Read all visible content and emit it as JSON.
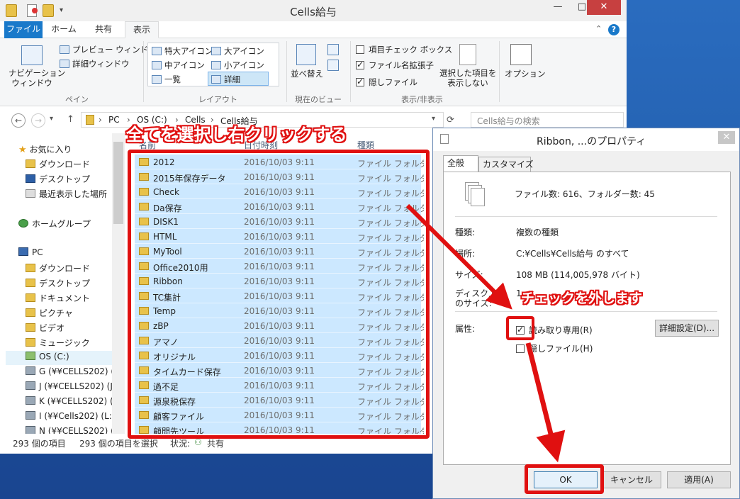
{
  "explorer": {
    "title": "Cells給与",
    "tabs": [
      "ファイル",
      "ホーム",
      "共有",
      "表示"
    ],
    "ribbon": {
      "pane": {
        "nav_pane": "ナビゲーション\nウィンドウ",
        "preview": "プレビュー ウィンドウ",
        "details": "詳細ウィンドウ",
        "group": "ペイン"
      },
      "layout": {
        "xl_icons": "特大アイコン",
        "l_icons": "大アイコン",
        "m_icons": "中アイコン",
        "s_icons": "小アイコン",
        "list": "一覧",
        "details": "詳細",
        "group": "レイアウト"
      },
      "current_view": {
        "sort": "並べ替え",
        "group": "現在のビュー"
      },
      "show_hide": {
        "item_checkbox": "項目チェック ボックス",
        "ext": "ファイル名拡張子",
        "hidden": "隠しファイル",
        "hide_selected": "選択した項目を\n表示しない",
        "group": "表示/非表示"
      },
      "options": "オプション"
    },
    "address": {
      "crumbs": [
        "PC",
        "OS (C:)",
        "Cells",
        "Cells給与"
      ],
      "search_placeholder": "Cells給与の検索"
    },
    "nav": {
      "favorites": "お気に入り",
      "fav_items": [
        "ダウンロード",
        "デスクトップ",
        "最近表示した場所"
      ],
      "homegroup": "ホームグループ",
      "pc": "PC",
      "pc_items": [
        "ダウンロード",
        "デスクトップ",
        "ドキュメント",
        "ピクチャ",
        "ビデオ",
        "ミュージック",
        "OS (C:)",
        "G (¥¥CELLS202) (",
        "J (¥¥CELLS202) (J",
        "K (¥¥CELLS202) (",
        "I (¥¥Cells202) (L:",
        "N (¥¥CELLS202) ("
      ]
    },
    "columns": {
      "name": "名前",
      "date": "日付時刻",
      "type": "種類"
    },
    "files": [
      {
        "name": "2012",
        "date": "2016/10/03 9:11",
        "type": "ファイル フォルダー"
      },
      {
        "name": "2015年保存データ",
        "date": "2016/10/03 9:11",
        "type": "ファイル フォルダー"
      },
      {
        "name": "Check",
        "date": "2016/10/03 9:11",
        "type": "ファイル フォルダー"
      },
      {
        "name": "Da保存",
        "date": "2016/10/03 9:11",
        "type": "ファイル フォルダー"
      },
      {
        "name": "DISK1",
        "date": "2016/10/03 9:11",
        "type": "ファイル フォルダー"
      },
      {
        "name": "HTML",
        "date": "2016/10/03 9:11",
        "type": "ファイル フォルダー"
      },
      {
        "name": "MyTool",
        "date": "2016/10/03 9:11",
        "type": "ファイル フォルダー"
      },
      {
        "name": "Office2010用",
        "date": "2016/10/03 9:11",
        "type": "ファイル フォルダー"
      },
      {
        "name": "Ribbon",
        "date": "2016/10/03 9:11",
        "type": "ファイル フォルダー"
      },
      {
        "name": "TC集計",
        "date": "2016/10/03 9:11",
        "type": "ファイル フォルダー"
      },
      {
        "name": "Temp",
        "date": "2016/10/03 9:11",
        "type": "ファイル フォルダー"
      },
      {
        "name": "zBP",
        "date": "2016/10/03 9:11",
        "type": "ファイル フォルダー"
      },
      {
        "name": "アマノ",
        "date": "2016/10/03 9:11",
        "type": "ファイル フォルダー"
      },
      {
        "name": "オリジナル",
        "date": "2016/10/03 9:11",
        "type": "ファイル フォルダー"
      },
      {
        "name": "タイムカード保存",
        "date": "2016/10/03 9:11",
        "type": "ファイル フォルダー"
      },
      {
        "name": "過不足",
        "date": "2016/10/03 9:11",
        "type": "ファイル フォルダー"
      },
      {
        "name": "源泉税保存",
        "date": "2016/10/03 9:11",
        "type": "ファイル フォルダー"
      },
      {
        "name": "顧客ファイル",
        "date": "2016/10/03 9:11",
        "type": "ファイル フォルダー"
      },
      {
        "name": "顧問先ツール",
        "date": "2016/10/03 9:11",
        "type": "ファイル フォルダー"
      }
    ],
    "status": {
      "count": "293 個の項目",
      "selected": "293 個の項目を選択",
      "state": "状況:",
      "shared": "共有"
    }
  },
  "annotations": {
    "select_all": "全てを選択し右クリックする",
    "uncheck": "チェックを外します"
  },
  "dialog": {
    "title": "Ribbon, ...のプロパティ",
    "tabs": [
      "全般",
      "カスタマイズ"
    ],
    "summary": "ファイル数: 616、フォルダー数: 45",
    "rows": [
      {
        "label": "種類:",
        "value": "複数の種類"
      },
      {
        "label": "場所:",
        "value": "C:¥Cells¥Cells給与 のすべて"
      },
      {
        "label": "サイズ:",
        "value": "108 MB (114,005,978 バイト)"
      },
      {
        "label": "ディスク上\nのサイズ:",
        "value": "1"
      }
    ],
    "attr_label": "属性:",
    "readonly": "読み取り専用(R)",
    "hidden": "隠しファイル(H)",
    "advanced": "詳細設定(D)...",
    "ok": "OK",
    "cancel": "キャンセル",
    "apply": "適用(A)"
  },
  "colors": {
    "accent": "#1979ca",
    "annotation": "#e01010",
    "selection": "#cce8ff"
  }
}
